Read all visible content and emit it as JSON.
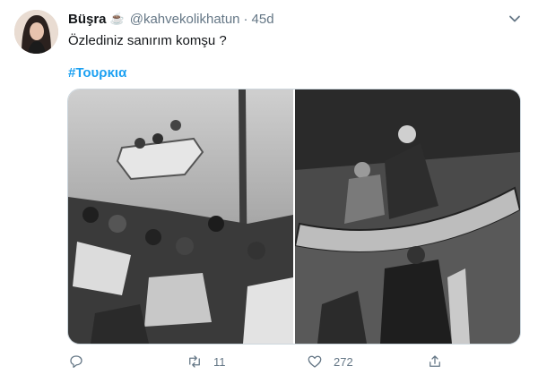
{
  "tweet": {
    "author": {
      "name": "Büşra",
      "emoji": "☕",
      "handle": "@kahvekolikhatun",
      "separator": "·",
      "time": "45d"
    },
    "text": "Özlediniz sanırım komşu ?",
    "hashtag": "#Τουρκια",
    "media": {
      "images": [
        {
          "icon": "photo-boats-crowd-icon"
        },
        {
          "icon": "photo-boat-people-icon"
        }
      ]
    },
    "actions": {
      "reply": {
        "icon": "reply-icon",
        "count": ""
      },
      "retweet": {
        "icon": "retweet-icon",
        "count": "11"
      },
      "like": {
        "icon": "heart-icon",
        "count": "272"
      },
      "share": {
        "icon": "share-icon",
        "count": ""
      }
    }
  },
  "colors": {
    "link": "#1da1f2",
    "secondary": "#657786",
    "text": "#14171a"
  }
}
